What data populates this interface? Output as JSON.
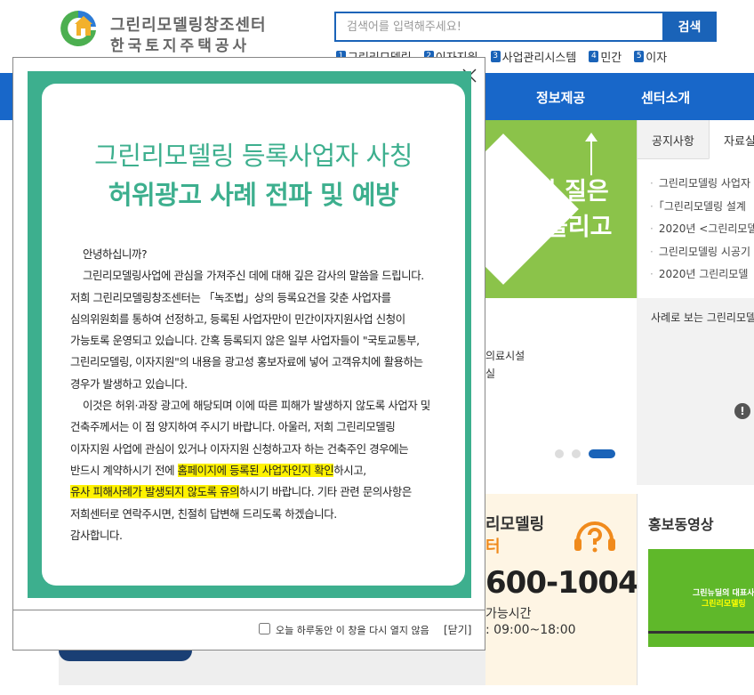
{
  "header": {
    "logo_line1": "그린리모델링창조센터",
    "logo_line2": "한국토지주택공사",
    "search": {
      "placeholder": "검색어를 입력해주세요!",
      "button": "검색"
    },
    "quick_links": [
      {
        "num": "1",
        "label": "그린리모델링"
      },
      {
        "num": "2",
        "label": "이자지원"
      },
      {
        "num": "3",
        "label": "사업관리시스템"
      },
      {
        "num": "4",
        "label": "민간"
      },
      {
        "num": "5",
        "label": "이자"
      }
    ]
  },
  "nav": {
    "items": [
      "정보제공",
      "센터소개"
    ]
  },
  "banner": {
    "line1": "삶의 질은",
    "line2": "올리고"
  },
  "notice": {
    "tabs": [
      "공지사항",
      "자료실"
    ],
    "items": [
      "그린리모델링 사업자",
      "「그린리모델링 설계",
      "2020년 <그린리모델",
      "그린리모델링 시공기",
      "2020년 그린리모델"
    ]
  },
  "case": {
    "title": "사례로 보는 그린리모델",
    "line1": "의료시설",
    "line2": "실"
  },
  "center": {
    "title1": "리모델링",
    "title2": "터",
    "phone": "600-1004",
    "hours_label": "가능시간",
    "hours": ": 09:00~18:00"
  },
  "video": {
    "title": "홍보동영상",
    "caption1": "그린뉴딜의 대표사업",
    "caption2": "그린리모델링"
  },
  "popup": {
    "title1": "그린리모델링 등록사업자 사칭",
    "title2": "허위광고 사례 전파 및 예방",
    "body": {
      "l1": "안녕하십니까?",
      "l2": "그린리모델링사업에 관심을 가져주신 데에 대해 깊은 감사의 말씀을 드립니다.",
      "l3": "저희 그린리모델링창조센터는 「녹조법」상의 등록요건을 갖춘 사업자를",
      "l4": "심의위원회를 통하여 선정하고, 등록된 사업자만이 민간이자지원사업 신청이",
      "l5": "가능토록 운영되고 있습니다. 간혹 등록되지 않은 일부 사업자들이 \"국토교통부,",
      "l6": "그린리모델링, 이자지원\"의 내용을 광고성 홍보자료에 넣어 고객유치에 활용하는",
      "l7": "경우가 발생하고 있습니다.",
      "l8": "이것은 허위·과장 광고에 해당되며 이에 따른 피해가 발생하지 않도록 사업자 및",
      "l9": "건축주께서는 이 점 양지하여 주시기 바랍니다. 아울러, 저희 그린리모델링",
      "l10": "이자지원 사업에 관심이 있거나 이자지원 신청하고자 하는 건축주인 경우에는",
      "l11a": "반드시 계약하시기 전에 ",
      "l11b": "홈페이지에 등록된 사업자인지 확인",
      "l11c": "하시고,",
      "l12a": "유사 피해사례가 발생되지 않도록 유의",
      "l12b": "하시기 바랍니다. 기타 관련 문의사항은",
      "l13": "저희센터로 연락주시면, 친절히 답변해 드리도록 하겠습니다.",
      "l14": "감사합니다."
    },
    "checkbox_label": "오늘 하루동안 이 창을 다시 열지 않음",
    "close_label": "[닫기]"
  },
  "colors": {
    "brand_blue": "#1867c9",
    "popup_green": "#3daf8e",
    "highlight": "#fff200",
    "banner_green": "#8bc34a",
    "accent_orange": "#f08a1c"
  }
}
